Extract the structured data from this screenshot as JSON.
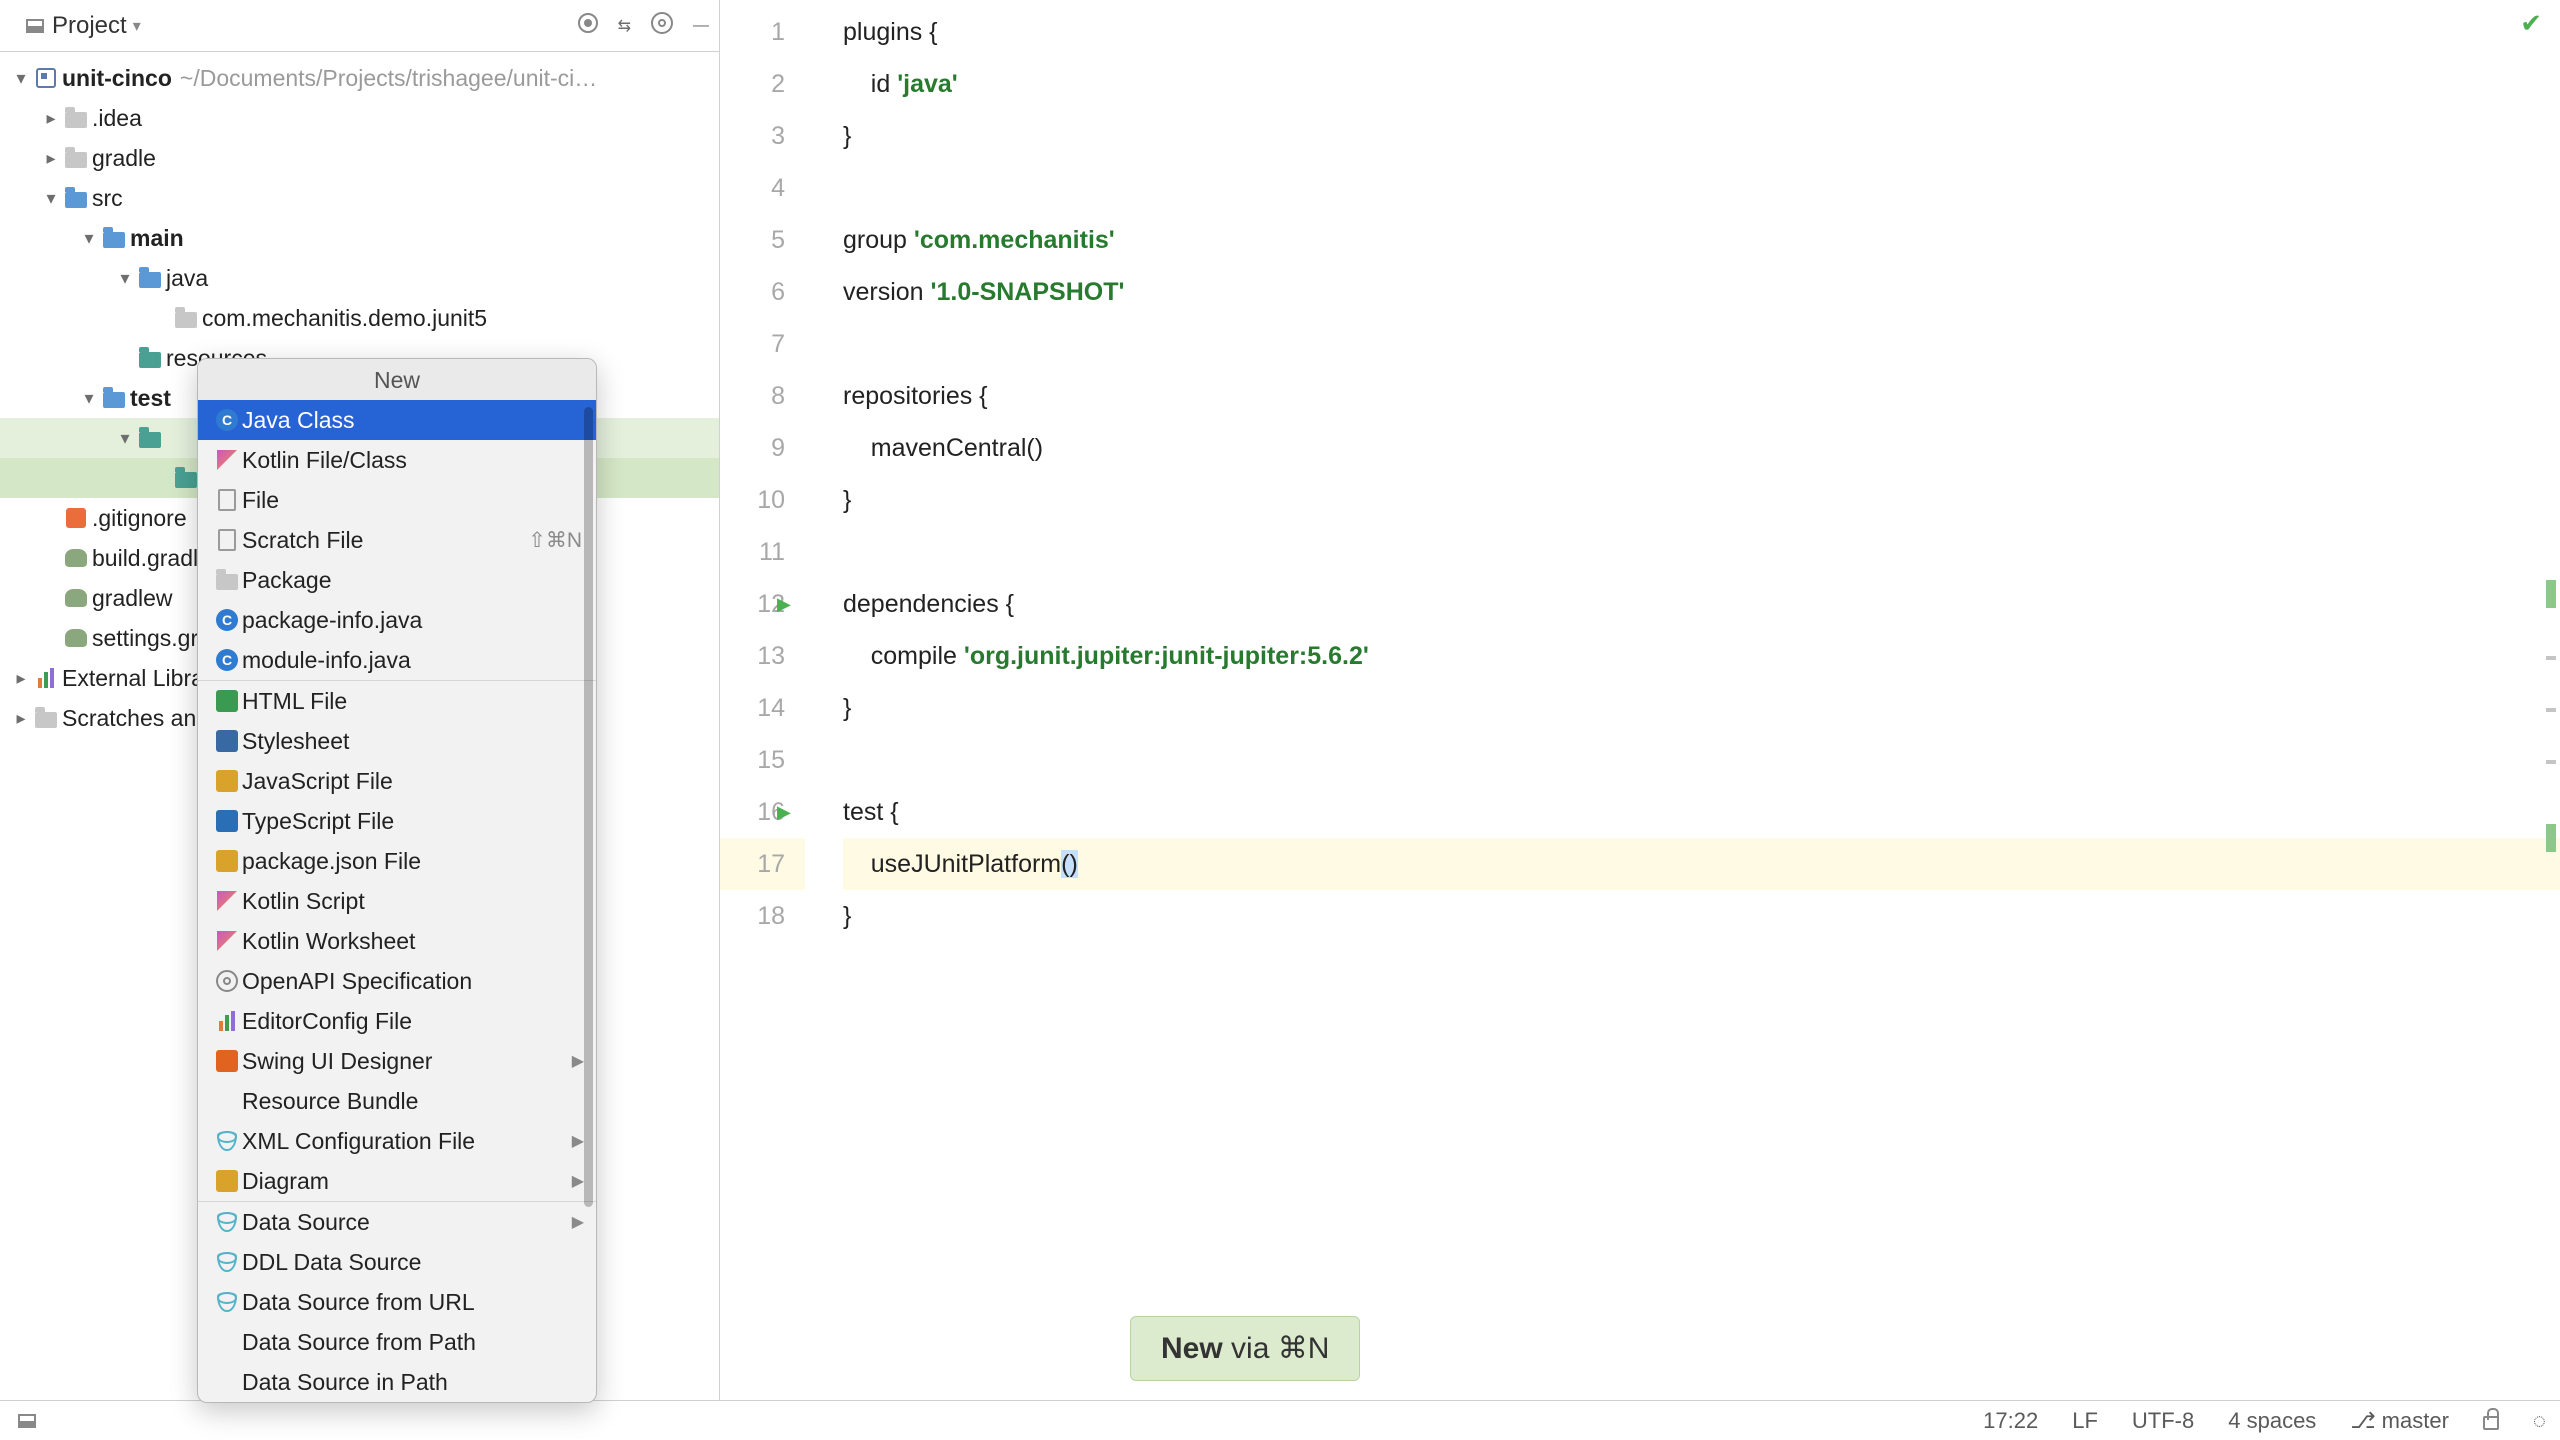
{
  "projectPanel": {
    "title": "Project",
    "root": {
      "name": "unit-cinco",
      "path": "~/Documents/Projects/trishagee/unit-ci…"
    },
    "nodes": [
      {
        "lbl": ".idea"
      },
      {
        "lbl": "gradle"
      },
      {
        "lbl": "src"
      },
      {
        "lbl": "main"
      },
      {
        "lbl": "java"
      },
      {
        "lbl": "com.mechanitis.demo.junit5"
      },
      {
        "lbl": "resources"
      },
      {
        "lbl": "test"
      },
      {
        "lbl": ".gitignore"
      },
      {
        "lbl": "build.gradle"
      },
      {
        "lbl": "gradlew"
      },
      {
        "lbl": "settings.gradle"
      },
      {
        "lbl": "External Libraries"
      },
      {
        "lbl": "Scratches and Consoles"
      }
    ]
  },
  "popup": {
    "title": "New",
    "items": [
      {
        "txt": "Java Class"
      },
      {
        "txt": "Kotlin File/Class"
      },
      {
        "txt": "File"
      },
      {
        "txt": "Scratch File",
        "sc": "⇧⌘N"
      },
      {
        "txt": "Package"
      },
      {
        "txt": "package-info.java"
      },
      {
        "txt": "module-info.java"
      },
      {
        "txt": "HTML File"
      },
      {
        "txt": "Stylesheet"
      },
      {
        "txt": "JavaScript File"
      },
      {
        "txt": "TypeScript File"
      },
      {
        "txt": "package.json File"
      },
      {
        "txt": "Kotlin Script"
      },
      {
        "txt": "Kotlin Worksheet"
      },
      {
        "txt": "OpenAPI Specification"
      },
      {
        "txt": "EditorConfig File"
      },
      {
        "txt": "Swing UI Designer",
        "sub": "▶"
      },
      {
        "txt": "Resource Bundle"
      },
      {
        "txt": "XML Configuration File",
        "sub": "▶"
      },
      {
        "txt": "Diagram",
        "sub": "▶"
      },
      {
        "txt": "Data Source",
        "sub": "▶"
      },
      {
        "txt": "DDL Data Source"
      },
      {
        "txt": "Data Source from URL"
      },
      {
        "txt": "Data Source from Path"
      },
      {
        "txt": "Data Source in Path"
      }
    ]
  },
  "editor": {
    "lines": [
      {
        "n": 1,
        "tokens": [
          {
            "t": "plugins {",
            "c": "pl"
          }
        ]
      },
      {
        "n": 2,
        "tokens": [
          {
            "t": "    id ",
            "c": "pl"
          },
          {
            "t": "'java'",
            "c": "str"
          }
        ]
      },
      {
        "n": 3,
        "tokens": [
          {
            "t": "}",
            "c": "pl"
          }
        ]
      },
      {
        "n": 4,
        "tokens": []
      },
      {
        "n": 5,
        "tokens": [
          {
            "t": "group ",
            "c": "pl"
          },
          {
            "t": "'com.mechanitis'",
            "c": "str"
          }
        ]
      },
      {
        "n": 6,
        "tokens": [
          {
            "t": "version ",
            "c": "pl"
          },
          {
            "t": "'1.0-SNAPSHOT'",
            "c": "str"
          }
        ]
      },
      {
        "n": 7,
        "tokens": []
      },
      {
        "n": 8,
        "tokens": [
          {
            "t": "repositories {",
            "c": "pl"
          }
        ]
      },
      {
        "n": 9,
        "tokens": [
          {
            "t": "    mavenCentral()",
            "c": "pl"
          }
        ]
      },
      {
        "n": 10,
        "tokens": [
          {
            "t": "}",
            "c": "pl"
          }
        ]
      },
      {
        "n": 11,
        "tokens": []
      },
      {
        "n": 12,
        "tokens": [
          {
            "t": "dependencies {",
            "c": "pl"
          }
        ],
        "run": true
      },
      {
        "n": 13,
        "tokens": [
          {
            "t": "    compile ",
            "c": "pl"
          },
          {
            "t": "'org.junit.jupiter:junit-jupiter:5.6.2'",
            "c": "str"
          }
        ]
      },
      {
        "n": 14,
        "tokens": [
          {
            "t": "}",
            "c": "pl"
          }
        ]
      },
      {
        "n": 15,
        "tokens": []
      },
      {
        "n": 16,
        "tokens": [
          {
            "t": "test {",
            "c": "pl"
          }
        ],
        "run": true
      },
      {
        "n": 17,
        "tokens": [
          {
            "t": "    useJUnitPlatform",
            "c": "pl"
          },
          {
            "t": "(",
            "c": "pl hi-paren"
          },
          {
            "t": ")",
            "c": "pl hi-paren"
          }
        ],
        "hl": true
      },
      {
        "n": 18,
        "tokens": [
          {
            "t": "}",
            "c": "pl"
          }
        ]
      }
    ]
  },
  "toast": {
    "bold": "New",
    "rest": " via ⌘N"
  },
  "status": {
    "time": "17:22",
    "eol": "LF",
    "enc": "UTF-8",
    "indent": "4 spaces",
    "branch": "master"
  }
}
